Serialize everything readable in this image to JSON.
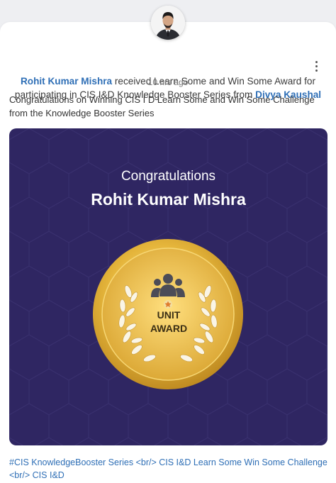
{
  "post": {
    "actor_name": "Rohit Kumar Mishra",
    "action_text": " received Learn Some and Win Some Award for participating in CIS I&D Knowledge Booster Series from ",
    "giver_name": "Divya Kaushal",
    "timestamp": "10 hrs ago",
    "message": "Congratulations on Winning CIS I D Learn Some and Win Some Challenge from the Knowledge Booster Series"
  },
  "award": {
    "heading": "Congratulations",
    "recipient": "Rohit Kumar Mishra",
    "line1": "UNIT",
    "line2": "AWARD",
    "card_color": "#2f2662",
    "medal_color": "#e2b53a"
  },
  "tags": {
    "text": "#CIS KnowledgeBooster Series <br/> CIS I&D Learn Some Win Some Challenge <br/> CIS I&D"
  },
  "icons": [
    "avatar",
    "more-vertical-icon",
    "people-group-icon",
    "star-icon",
    "laurel-wreath-icon"
  ]
}
